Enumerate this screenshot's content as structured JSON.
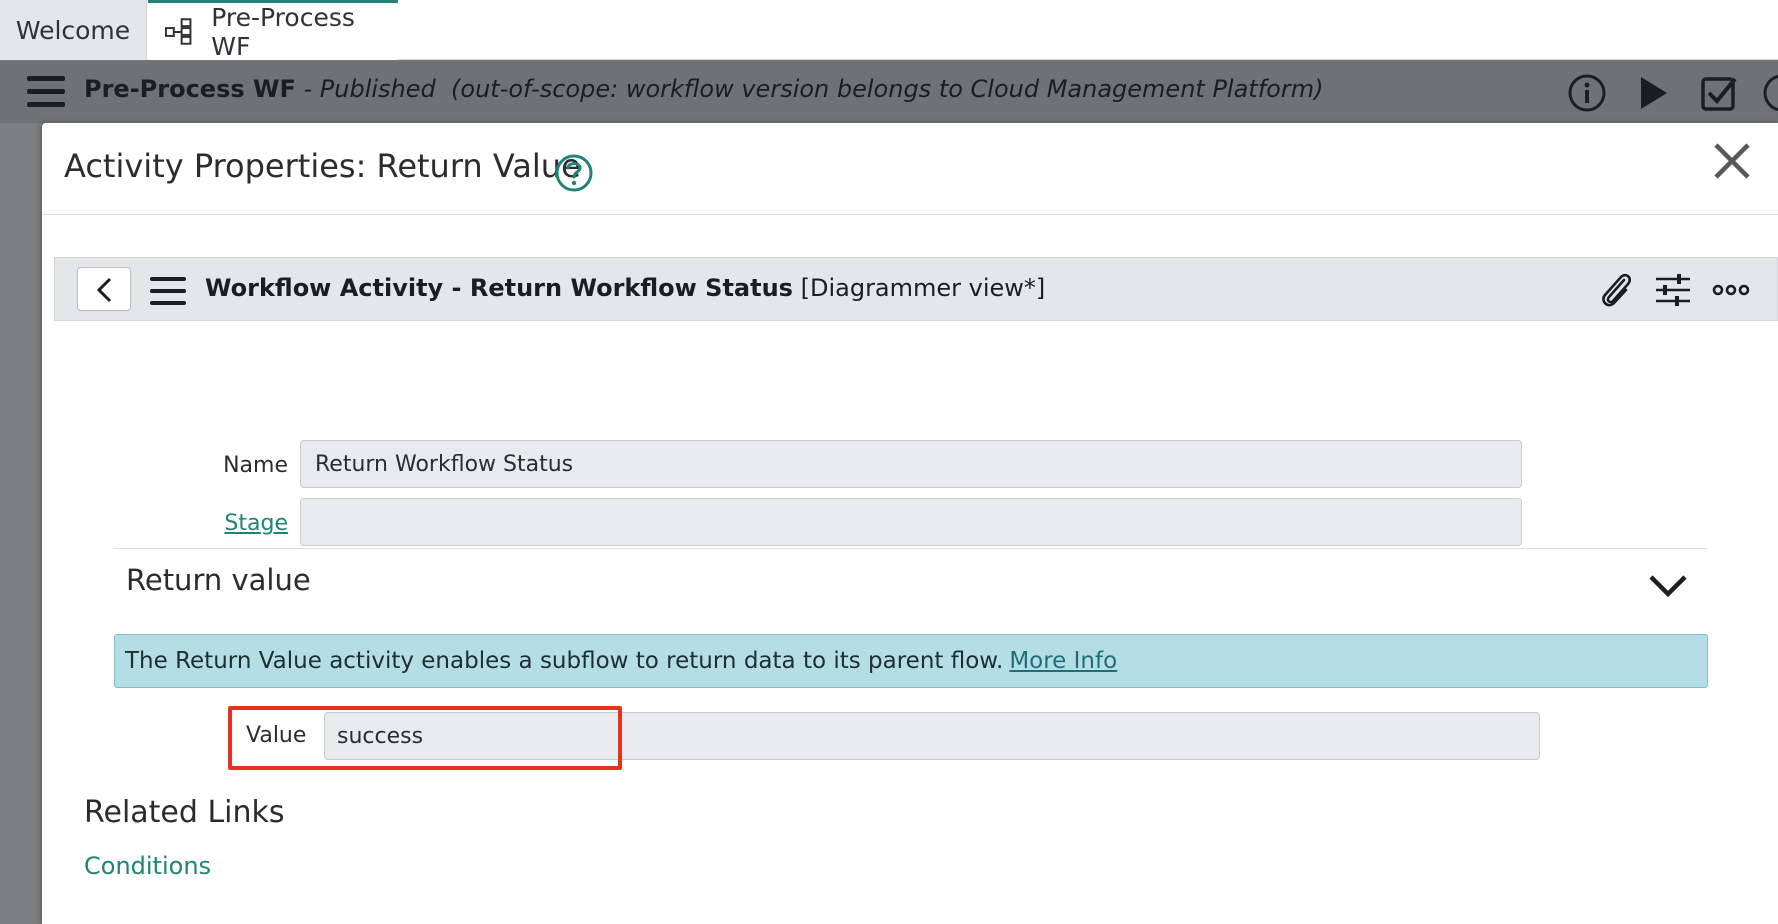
{
  "tabs": [
    {
      "label": "Welcome"
    },
    {
      "label": "Pre-Process WF"
    }
  ],
  "workflow_bar": {
    "name": "Pre-Process WF",
    "separator": " - ",
    "state": "Published",
    "scope_note": "(out-of-scope: workflow version belongs to Cloud Management Platform)",
    "icons": [
      "menu-icon",
      "info-icon",
      "play-icon",
      "checkbox-icon",
      "more-icon"
    ]
  },
  "modal": {
    "title": "Activity Properties: Return Value",
    "icons": [
      "help-icon",
      "close-icon"
    ]
  },
  "form_header": {
    "title_bold": "Workflow Activity - Return Workflow Status",
    "view": "[Diagrammer view*]",
    "icons": [
      "back-icon",
      "menu-icon",
      "paperclip-icon",
      "sliders-icon",
      "ellipsis-icon"
    ]
  },
  "fields": {
    "name_label": "Name",
    "name_value": "Return Workflow Status",
    "stage_label": "Stage",
    "stage_value": ""
  },
  "section": {
    "title": "Return value",
    "info_text": "The Return Value activity enables a subflow to return data to its parent flow.",
    "info_link": "More Info",
    "value_label": "Value",
    "value_value": "success"
  },
  "related": {
    "title": "Related Links",
    "links": [
      {
        "label": "Conditions"
      }
    ]
  },
  "colors": {
    "accent": "#1f8476",
    "info_bg": "#b5dde5",
    "highlight": "#e8321e"
  }
}
